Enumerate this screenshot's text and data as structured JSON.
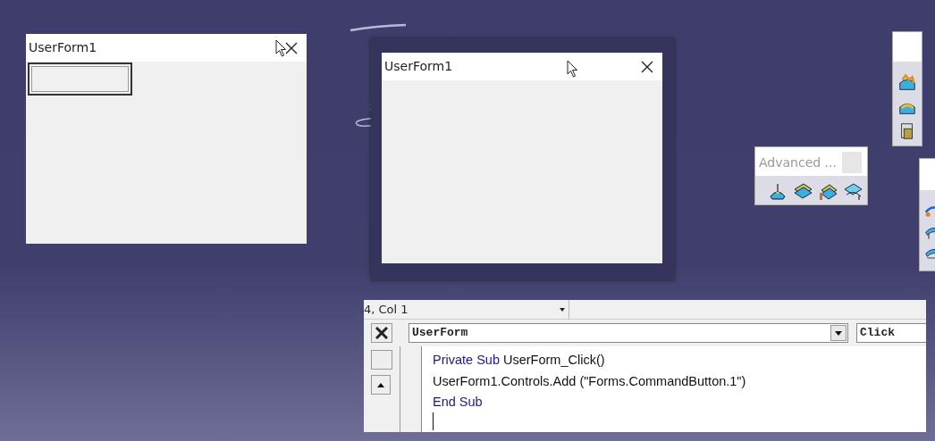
{
  "forms": [
    {
      "title": "UserForm1",
      "has_button": true,
      "cursor_on_close": true
    },
    {
      "title": "UserForm1",
      "has_button": false,
      "cursor_on_close": false
    }
  ],
  "toolbars": [
    {
      "title": "Advanced ..."
    }
  ],
  "code_window": {
    "position": "4, Col 1",
    "object": "UserForm",
    "procedure": "Click",
    "lines": [
      [
        {
          "kind": "keyword",
          "text": "Private Sub"
        },
        {
          "kind": "plain",
          "text": " UserForm_Click()"
        }
      ],
      [
        {
          "kind": "plain",
          "text": "UserForm1.Controls.Add (\"Forms.CommandButton.1\")"
        }
      ],
      [
        {
          "kind": "keyword",
          "text": "End Sub"
        }
      ]
    ]
  }
}
